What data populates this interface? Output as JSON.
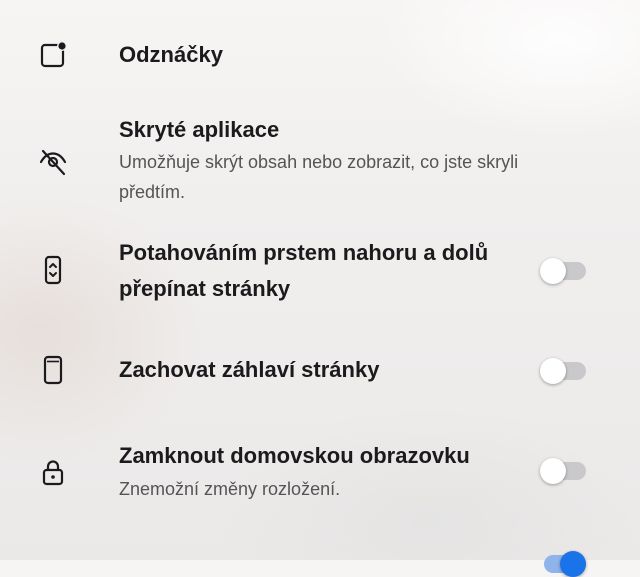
{
  "settings": {
    "items": [
      {
        "title": "Odznáčky",
        "icon": "badge-icon"
      },
      {
        "title": "Skryté aplikace",
        "subtitle": "Umožňuje skrýt obsah nebo zobrazit, co jste skryli předtím.",
        "icon": "eye-off-icon"
      },
      {
        "title": "Potahováním prstem nahoru a dolů přepínat stránky",
        "icon": "swipe-vertical-icon",
        "toggle": false
      },
      {
        "title": "Zachovat záhlaví stránky",
        "icon": "phone-icon",
        "toggle": false
      },
      {
        "title": "Zamknout domovskou obrazovku",
        "subtitle": "Znemožní změny rozložení.",
        "icon": "lock-icon",
        "toggle": false
      },
      {
        "toggle": true
      }
    ]
  },
  "colors": {
    "accent": "#1a73e8",
    "toggle_off_track": "#c9c9cb"
  }
}
